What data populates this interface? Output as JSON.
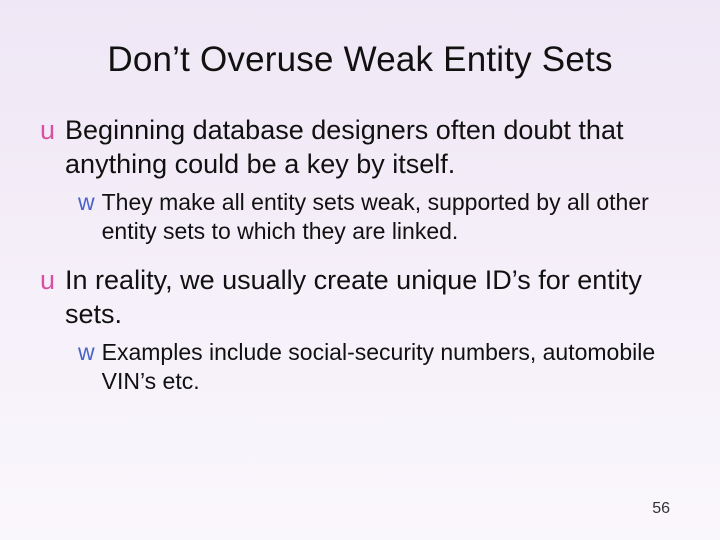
{
  "title": "Don’t Overuse Weak Entity Sets",
  "items": [
    {
      "marker": "u",
      "level": 1,
      "text": "Beginning database designers often doubt that anything could be a key by itself."
    },
    {
      "marker": "w",
      "level": 2,
      "text": "They make all entity sets weak, supported by all other entity sets to which they are linked."
    },
    {
      "marker": "u",
      "level": 1,
      "text": "In reality, we usually create unique ID’s for entity sets."
    },
    {
      "marker": "w",
      "level": 2,
      "text": "Examples include social-security numbers, automobile VIN’s etc."
    }
  ],
  "page_number": "56"
}
